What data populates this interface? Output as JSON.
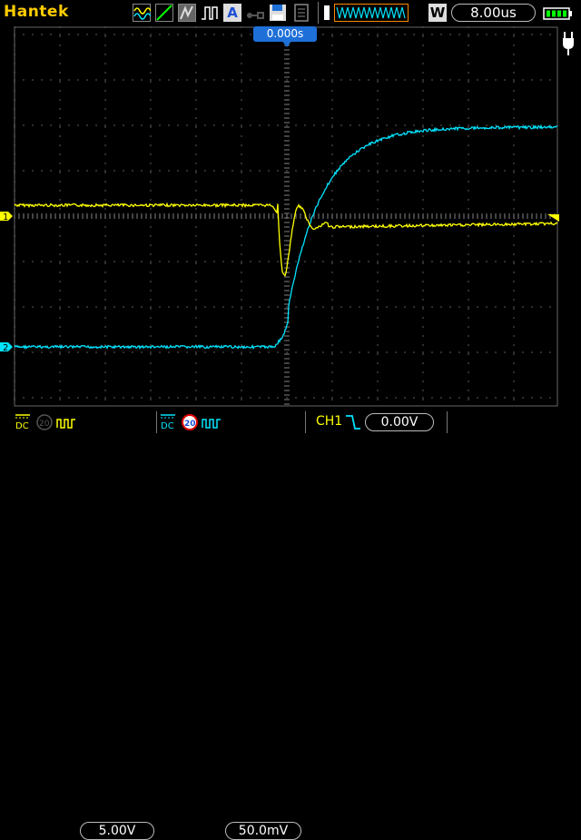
{
  "brand": "Hantek",
  "timebase": "8.00us",
  "run_mode": "W",
  "trigger_mode": "A",
  "trigger_time": "0.000s",
  "icons": {
    "waveform_1": "sine-wave-icon",
    "waveform_2": "ramp-icon",
    "waveform_3": "persist-icon",
    "waveform_4": "pulse-icon",
    "save": "floppy-disk-icon",
    "memory": "memory-icon",
    "battery": "battery-icon",
    "power": "power-plug-icon"
  },
  "channels": {
    "ch1": {
      "marker": "1",
      "coupling": "DC",
      "bw": "20",
      "scale": "5.00V",
      "color": "#ffff00"
    },
    "ch2": {
      "marker": "2",
      "coupling": "DC",
      "bw": "20",
      "scale": "50.0mV",
      "color": "#00e5ff"
    }
  },
  "trigger": {
    "source": "CH1",
    "slope": "falling",
    "level": "0.00V",
    "color": "#ffff00"
  },
  "colors": {
    "grid": "#7f7f7f",
    "accent": "#1e6fd8",
    "brand": "#ffcc00"
  }
}
